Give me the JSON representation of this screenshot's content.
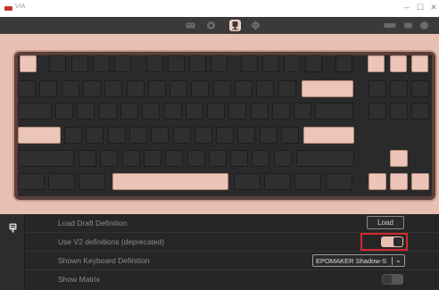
{
  "window": {
    "title": "VIA",
    "controls": [
      "–",
      "☐",
      "✕"
    ]
  },
  "toolbar": {
    "tools": [
      "keyboard-icon",
      "gear-circle-icon",
      "debug-icon",
      "settings-icon",
      "design-icon"
    ],
    "active_tool": "debug-icon",
    "accent_color": "#f0cfc4"
  },
  "keyboard": {
    "keycap_color": "#2f2f2f",
    "accent_color": "#ecc4b8"
  },
  "settings": {
    "rows": [
      {
        "label": "Load Draft Definition",
        "control": "button",
        "button_label": "Load"
      },
      {
        "label": "Use V2 definitions (deprecated)",
        "control": "toggle",
        "state": "on"
      },
      {
        "label": "Shown Keyboard Definition",
        "control": "select",
        "value": "EPOMAKER Shadow-S"
      },
      {
        "label": "Show Matrix",
        "control": "toggle",
        "state": "off"
      }
    ]
  }
}
